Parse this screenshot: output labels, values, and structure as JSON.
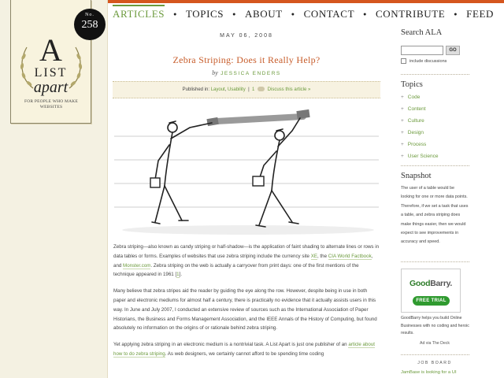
{
  "branding": {
    "letter": "A",
    "list": "LIST",
    "apart": "apart",
    "tagline": "FOR PEOPLE WHO MAKE WEBSITES",
    "issue_label": "No.",
    "issue_number": "258"
  },
  "nav": {
    "items": [
      "ARTICLES",
      "TOPICS",
      "ABOUT",
      "CONTACT",
      "CONTRIBUTE",
      "FEED"
    ],
    "active": "ARTICLES"
  },
  "article": {
    "date": "MAY 06, 2008",
    "title": "Zebra Striping: Does it Really Help?",
    "by": "by",
    "author": "JESSICA ENDERS",
    "published_in": "Published in:",
    "category_1": "Layout",
    "category_2": "Usability",
    "comment_count": "1",
    "discuss": "Discuss this article »",
    "p1": {
      "a": "Zebra striping—also known as candy striping or half-shadow—is the application of faint shading to alternate lines or rows in data tables or forms. Examples of websites that use zebra striping include the currency site ",
      "xe": "XE",
      "b": ", the ",
      "factbook": "CIA World Factbook",
      "c": ", and ",
      "monster": "Monster.com",
      "d": ". Zebra striping on the web is actually a carryover from print days: one of the first mentions of the technique appeared in 1961 [",
      "ref": "1",
      "e": "]."
    },
    "p2": "Many believe that zebra stripes aid the reader by guiding the eye along the row. However, despite being in use in both paper and electronic mediums for almost half a century, there is practically no evidence that it actually assists users in this way. In June and July 2007, I conducted an extensive review of sources such as the International Association of Paper Historians, the Business and Forms Management Association, and the IEEE Annals of the History of Computing, but found absolutely no information on the origins of or rationale behind zebra striping.",
    "p3": {
      "a": "Yet applying zebra striping in an electronic medium is a nontrivial task. A List Apart is just one publisher of an ",
      "link": "article about how to do zebra striping",
      "b": ". As web designers, we certainly cannot afford to be spending time coding"
    }
  },
  "sidebar": {
    "search_heading": "Search ALA",
    "search_value": "",
    "go_label": "GO",
    "include_discussions": "include discussions",
    "topics_heading": "Topics",
    "topics": [
      "Code",
      "Content",
      "Culture",
      "Design",
      "Process",
      "User Science"
    ],
    "snapshot_heading": "Snapshot",
    "snapshot_text": "The user of a table would be looking for one or more data points. Therefore, if we set a task that uses a table, and zebra striping does make things easier, then we would expect to see improvements in accuracy and speed.",
    "ad_logo_1": "Good",
    "ad_logo_2": "Barry.",
    "ad_trial": "FREE TRIAL",
    "ad_text": "GoodBarry helps you build Online Businesses with no coding and heroic results.",
    "ad_via": "Ad via The Deck",
    "job_board_heading": "JOB BOARD",
    "job_item": "JamBase is looking for a UI"
  },
  "colors": {
    "accent_orange": "#d5561e",
    "title_orange": "#c75c2a",
    "link_green": "#6b9a3c",
    "ad_green": "#2f9a2f"
  }
}
